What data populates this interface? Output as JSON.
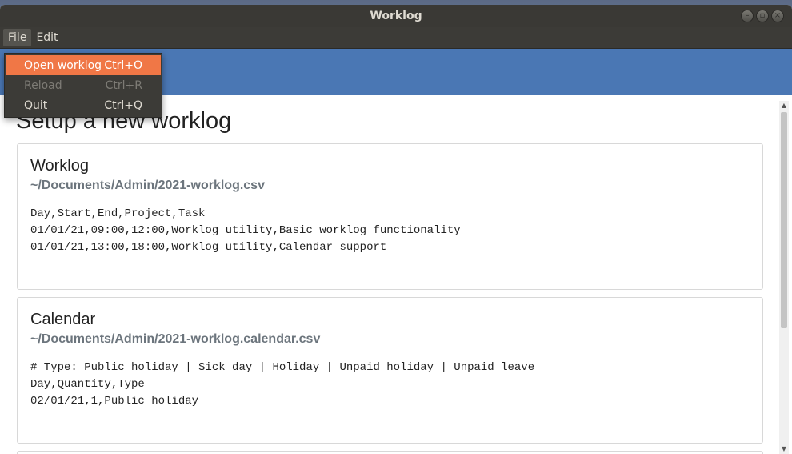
{
  "window": {
    "title": "Worklog"
  },
  "menubar": {
    "items": [
      {
        "label": "File"
      },
      {
        "label": "Edit"
      }
    ]
  },
  "file_menu": {
    "items": [
      {
        "label": "Open worklog",
        "shortcut": "Ctrl+O"
      },
      {
        "label": "Reload",
        "shortcut": "Ctrl+R"
      },
      {
        "label": "Quit",
        "shortcut": "Ctrl+Q"
      }
    ]
  },
  "main": {
    "title": "Setup a new worklog",
    "cards": [
      {
        "title": "Worklog",
        "path": "~/Documents/Admin/2021-worklog.csv",
        "content": "Day,Start,End,Project,Task\n01/01/21,09:00,12:00,Worklog utility,Basic worklog functionality\n01/01/21,13:00,18:00,Worklog utility,Calendar support"
      },
      {
        "title": "Calendar",
        "path": "~/Documents/Admin/2021-worklog.calendar.csv",
        "content": "# Type: Public holiday | Sick day | Holiday | Unpaid holiday | Unpaid leave\nDay,Quantity,Type\n02/01/21,1,Public holiday"
      }
    ]
  },
  "colors": {
    "accent": "#f07746",
    "banner": "#4a77b4",
    "titlebar": "#3a3935"
  }
}
